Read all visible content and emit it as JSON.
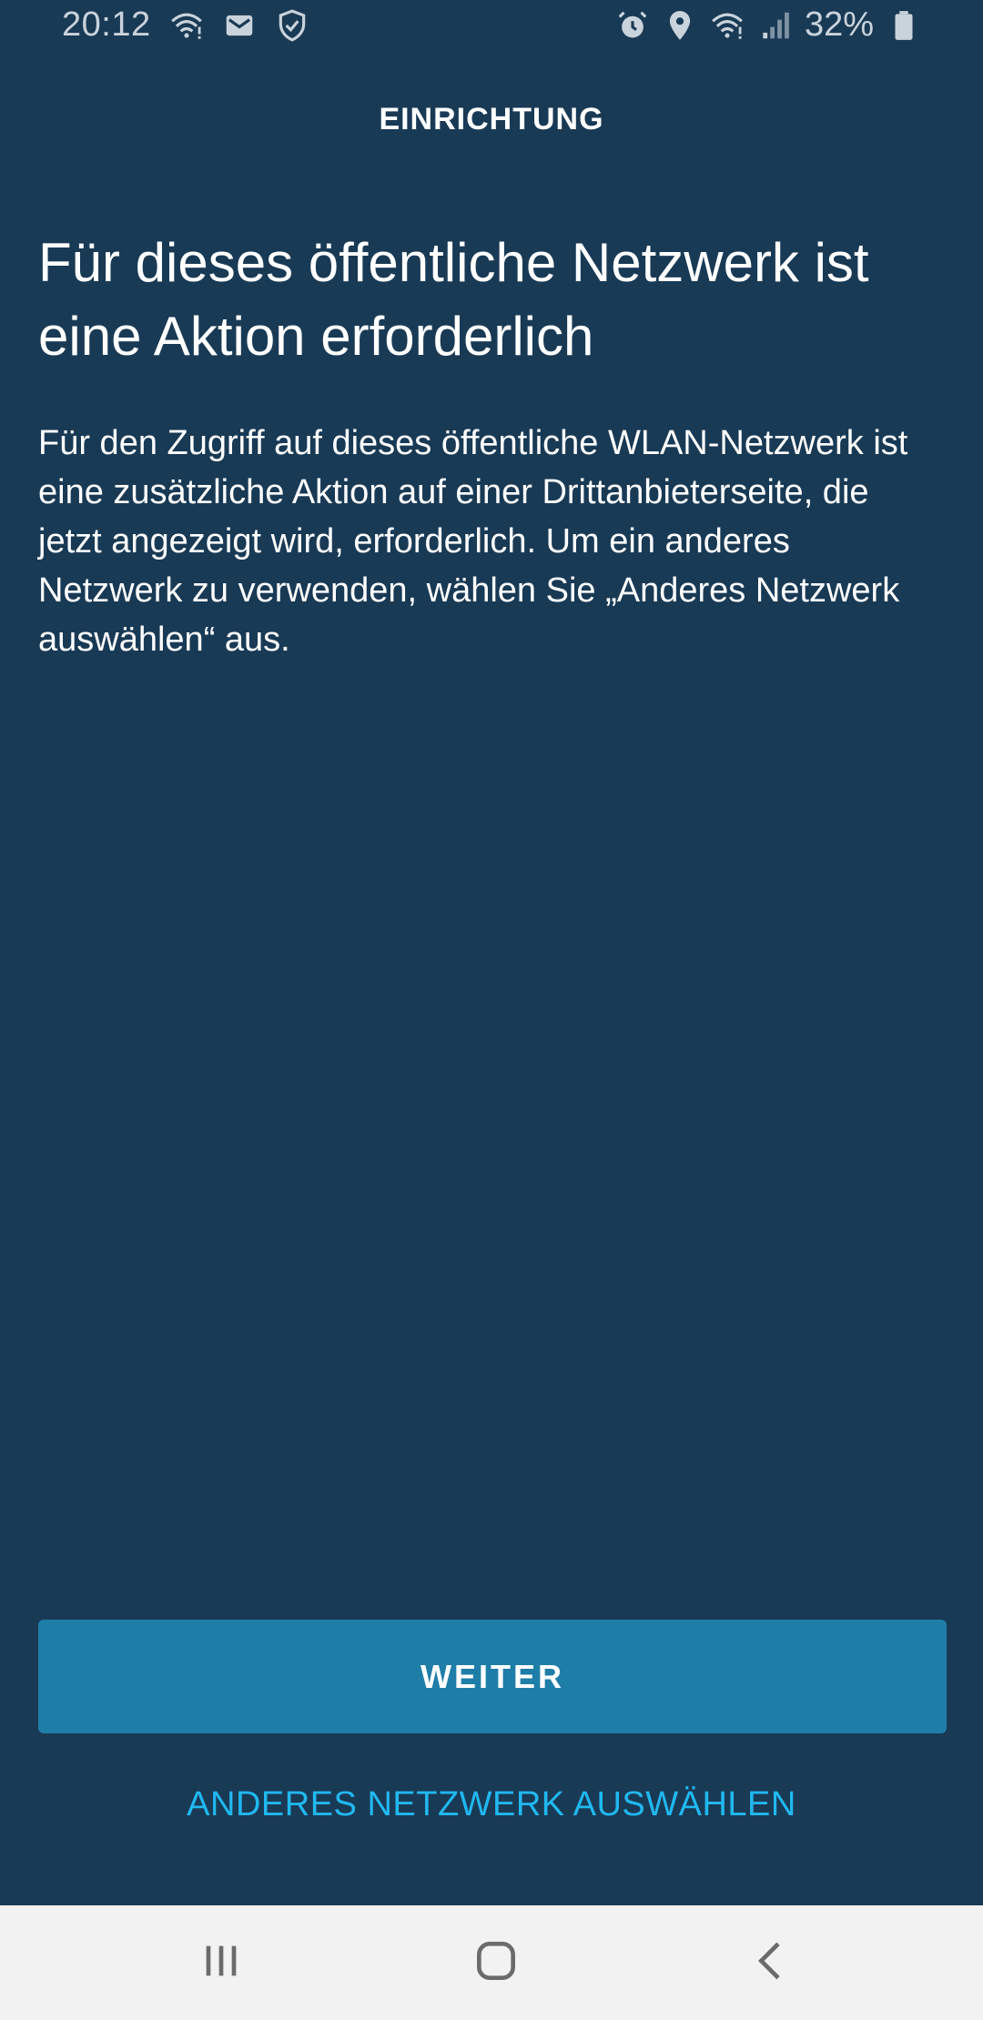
{
  "status_bar": {
    "time": "20:12",
    "battery_percent": "32%",
    "left_icons": [
      "wifi-icon",
      "mail-icon",
      "shield-icon"
    ],
    "right_icons": [
      "alarm-icon",
      "location-icon",
      "wifi-icon",
      "signal-icon",
      "battery-icon"
    ]
  },
  "header": {
    "title": "EINRICHTUNG"
  },
  "main": {
    "headline": "Für dieses öffentliche Netzwerk ist eine Aktion erforderlich",
    "body": "Für den Zugriff auf dieses öffentliche WLAN-Netzwerk ist eine zusätzliche Aktion auf einer Drittanbieterseite, die jetzt angezeigt wird, erforderlich. Um ein anderes Netzwerk zu verwenden, wählen Sie „Anderes Netzwerk auswählen“ aus."
  },
  "actions": {
    "primary_label": "WEITER",
    "secondary_label": "ANDERES NETZWERK AUSWÄHLEN"
  },
  "nav_bar": {
    "buttons": [
      "recents-icon",
      "home-icon",
      "back-icon"
    ]
  },
  "colors": {
    "background": "#193a55",
    "primary_button": "#1f7ea8",
    "link": "#21b8f0",
    "nav_bar": "#f2f2f2"
  }
}
